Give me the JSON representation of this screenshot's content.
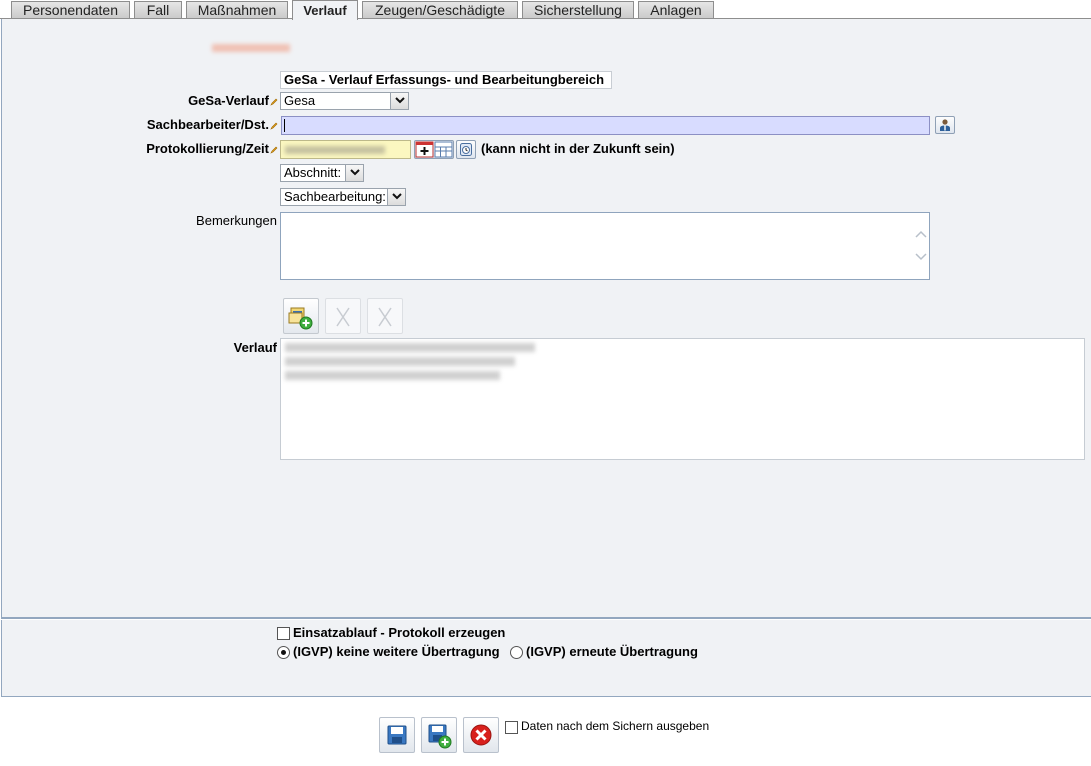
{
  "tabs": [
    {
      "label": "Personendaten"
    },
    {
      "label": "Fall"
    },
    {
      "label": "Maßnahmen"
    },
    {
      "label": "Verlauf",
      "active": true
    },
    {
      "label": "Zeugen/Geschädigte"
    },
    {
      "label": "Sicherstellung"
    },
    {
      "label": "Anlagen"
    }
  ],
  "section_title": "GeSa - Verlauf Erfassungs- und Bearbeitungbereich",
  "form": {
    "gesa_verlauf": {
      "label": "GeSa-Verlauf",
      "value": "Gesa"
    },
    "sachbearbeiter": {
      "label": "Sachbearbeiter/Dst.",
      "value": ""
    },
    "protokollierung": {
      "label": "Protokollierung/Zeit",
      "note": "(kann nicht in der Zukunft sein)"
    },
    "abschnitt": {
      "value": "Abschnitt:"
    },
    "sachbearbeitung": {
      "value": "Sachbearbeitung:"
    },
    "bemerkungen": {
      "label": "Bemerkungen",
      "value": ""
    },
    "verlauf": {
      "label": "Verlauf"
    }
  },
  "options": {
    "einsatzablauf": {
      "label": "Einsatzablauf - Protokoll erzeugen",
      "checked": false
    },
    "igvp_keine": {
      "label": "(IGVP) keine weitere Übertragung",
      "checked": true
    },
    "igvp_erneut": {
      "label": "(IGVP) erneute Übertragung",
      "checked": false
    }
  },
  "footer": {
    "ausgeben_label": "Daten nach dem Sichern ausgeben",
    "ausgeben_checked": false
  },
  "icons": {
    "pencil": "required-pencil-icon",
    "person_lookup": "person-lookup-icon",
    "calendar": "calendar-icon",
    "clock": "clock-icon",
    "add_entry": "add-entry-icon",
    "save": "save-icon",
    "save_new": "save-new-icon",
    "cancel": "cancel-icon"
  },
  "colors": {
    "panel_bg": "#f0f2f5",
    "required_field": "#d8dcff",
    "date_field": "#fbf7c0",
    "border_blue": "#93a7bf",
    "pencil": "#e0a020",
    "cancel_red": "#d8201c"
  }
}
